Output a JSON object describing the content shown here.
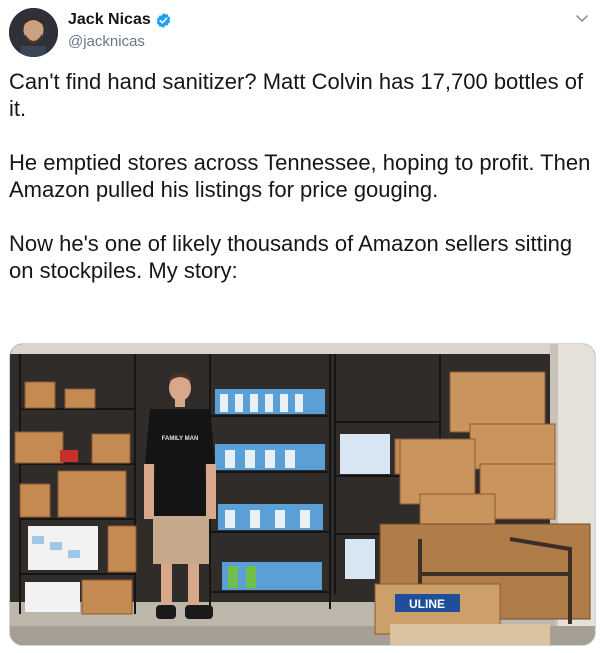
{
  "author": {
    "name": "Jack Nicas",
    "handle": "@jacknicas",
    "verified": true
  },
  "tweet": {
    "paragraphs": [
      "Can't find hand sanitizer? Matt Colvin has 17,700 bottles of it.",
      "He emptied stores across Tennessee, hoping to profit. Then Amazon pulled his listings for price gouging.",
      "Now he's one of likely thousands of Amazon sellers sitting on stockpiles. My story:"
    ]
  },
  "photo": {
    "shirt_text": "FAMILY MAN",
    "box_label": "ULINE"
  },
  "icons": {
    "verified": "verified-badge-icon",
    "menu": "chevron-down-icon"
  },
  "colors": {
    "verified_blue": "#1da1f2",
    "handle_gray": "#657786"
  }
}
